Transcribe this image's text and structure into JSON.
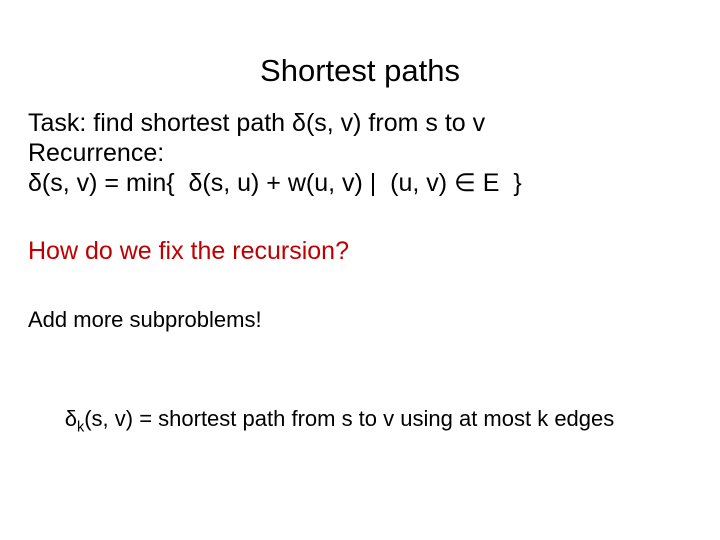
{
  "slide": {
    "title": "Shortest paths",
    "background_color": "#ffffff",
    "text_color": "#000000",
    "accent_color": "#c00000",
    "body": {
      "task_line": "Task: find shortest path δ(s, v) from s to v",
      "recurrence_label": "Recurrence:",
      "recurrence_formula": "δ(s, v) = min{  δ(s, u) + w(u, v) |  (u, v) ∈ E  }",
      "question_line": "How do we fix the recursion?",
      "answer_line": "Add more subproblems!",
      "definition": {
        "symbol": "δ",
        "subscript": "k",
        "rest": "(s, v) = shortest path from s to v using at most k edges"
      }
    }
  }
}
